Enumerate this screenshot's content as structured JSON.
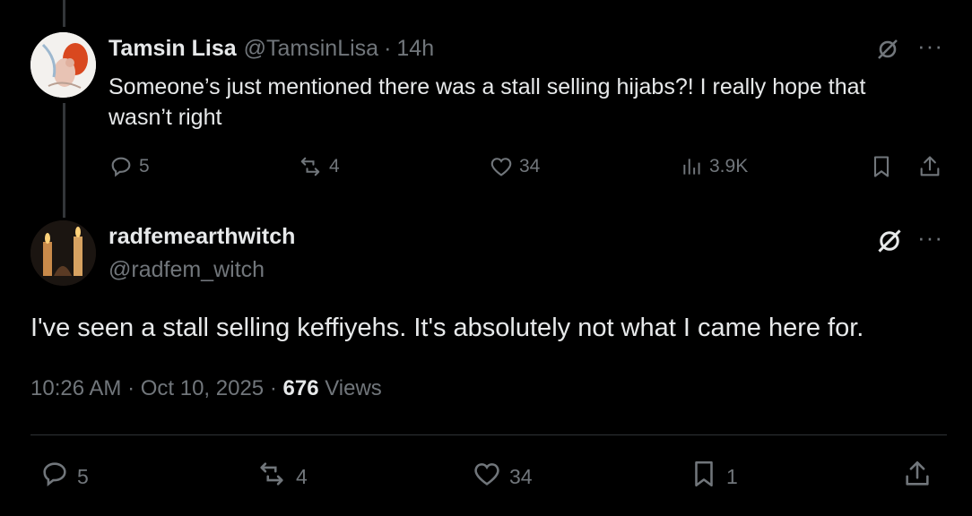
{
  "parent_tweet": {
    "display_name": "Tamsin Lisa",
    "handle": "@TamsinLisa",
    "separator": "·",
    "time": "14h",
    "text": "Someone’s just mentioned there was a stall selling hijabs?! I really hope that wasn’t right",
    "replies": "5",
    "reposts": "4",
    "likes": "34",
    "views": "3.9K"
  },
  "main_tweet": {
    "display_name": "radfemearthwitch",
    "handle": "@radfem_witch",
    "text": "I've seen a stall selling keffiyehs. It's absolutely not what I came here for.",
    "timestamp": "10:26 AM · Oct 10, 2025",
    "meta_separator": "·",
    "view_count": "676",
    "views_label": "Views",
    "replies": "5",
    "reposts": "4",
    "likes": "34",
    "bookmarks": "1"
  },
  "icons": {
    "reply": "reply-icon",
    "repost": "repost-icon",
    "like": "heart-icon",
    "views": "analytics-icon",
    "bookmark": "bookmark-icon",
    "share": "share-icon",
    "grok": "grok-icon",
    "more": "more-icon"
  },
  "colors": {
    "background": "#000000",
    "text_primary": "#e7e9ea",
    "text_secondary": "#71767b",
    "divider": "#2f3336"
  }
}
